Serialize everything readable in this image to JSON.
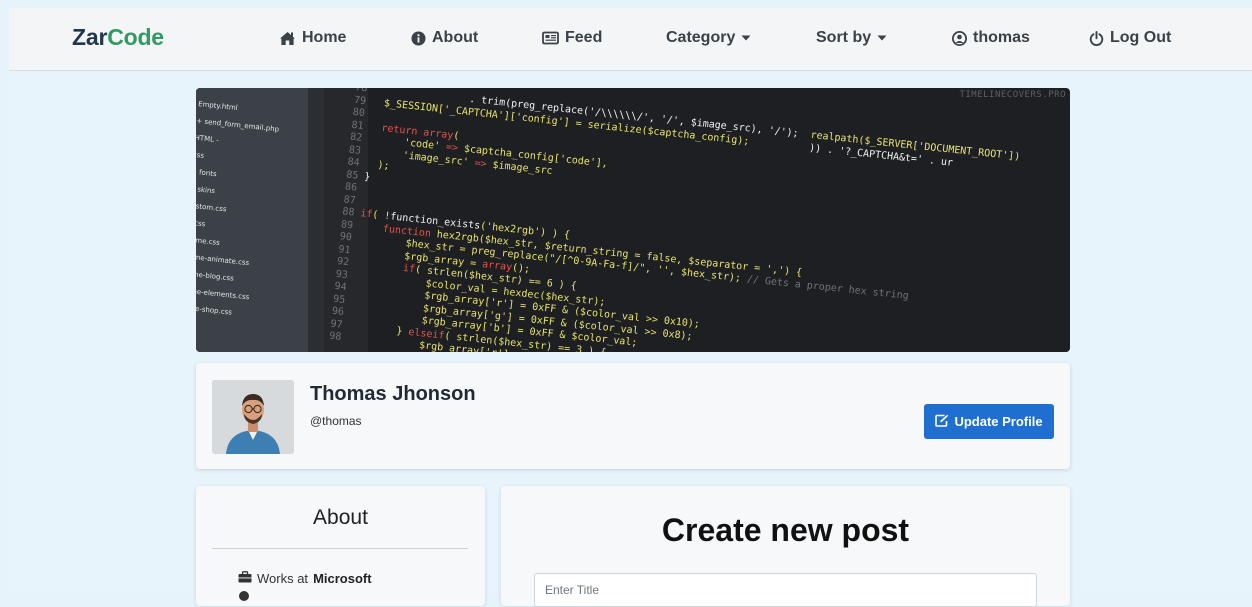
{
  "brand": {
    "part1": "Zar",
    "part2": "Code"
  },
  "nav": {
    "home": "Home",
    "about": "About",
    "feed": "Feed",
    "category": "Category",
    "sort_by": "Sort by",
    "user": "thomas",
    "logout": "Log Out"
  },
  "cover": {
    "watermark": "TIMELINECOVERS.PRO",
    "files": [
      "Empty.html",
      "+ send_form_email.php",
      "HTML -",
      "css",
      "+ fonts",
      "+ skins",
      "custom.css",
      "ie.css",
      "theme.css",
      "theme-animate.css",
      "theme-blog.css",
      "theme-elements.css",
      "theme-shop.css"
    ]
  },
  "profile": {
    "name": "Thomas Jhonson",
    "handle": "@thomas",
    "update_label": "Update Profile"
  },
  "about": {
    "title": "About",
    "works_prefix": "Works at",
    "company": "Microsoft"
  },
  "post": {
    "title": "Create new post",
    "title_placeholder": "Enter Title"
  },
  "colors": {
    "brand_dark": "#22364c",
    "brand_green": "#2f9a63",
    "primary": "#1f6fd1",
    "background": "#e8f4fc"
  }
}
